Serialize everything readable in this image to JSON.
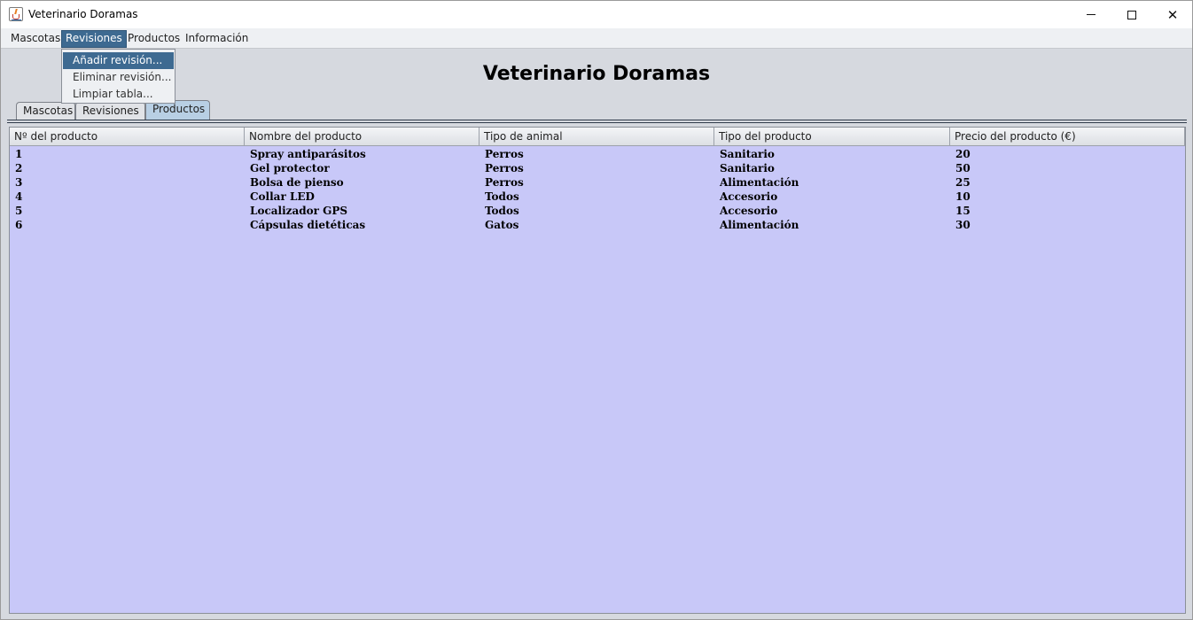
{
  "window": {
    "title": "Veterinario Doramas"
  },
  "menubar": {
    "items": [
      "Mascotas",
      "Revisiones",
      "Productos",
      "Información"
    ]
  },
  "dropdown": {
    "items": [
      "Añadir revisión...",
      "Eliminar revisión...",
      "Limpiar tabla..."
    ]
  },
  "heading": "Veterinario Doramas",
  "tabs": [
    "Mascotas",
    "Revisiones",
    "Productos"
  ],
  "table": {
    "headers": [
      "Nº del producto",
      "Nombre del producto",
      "Tipo de animal",
      "Tipo del producto",
      "Precio del producto (€)"
    ],
    "rows": [
      [
        "1",
        "Spray antiparásitos",
        "Perros",
        "Sanitario",
        "20"
      ],
      [
        "2",
        "Gel protector",
        "Perros",
        "Sanitario",
        "50"
      ],
      [
        "3",
        "Bolsa de pienso",
        "Perros",
        "Alimentación",
        "25"
      ],
      [
        "4",
        "Collar LED",
        "Todos",
        "Accesorio",
        "10"
      ],
      [
        "5",
        "Localizador GPS",
        "Todos",
        "Accesorio",
        "15"
      ],
      [
        "6",
        "Cápsulas dietéticas",
        "Gatos",
        "Alimentación",
        "30"
      ]
    ]
  },
  "colors": {
    "accent": "#3e6a91",
    "table_bg": "#c8c8f8",
    "selected_tab": "#b8cfe4"
  }
}
